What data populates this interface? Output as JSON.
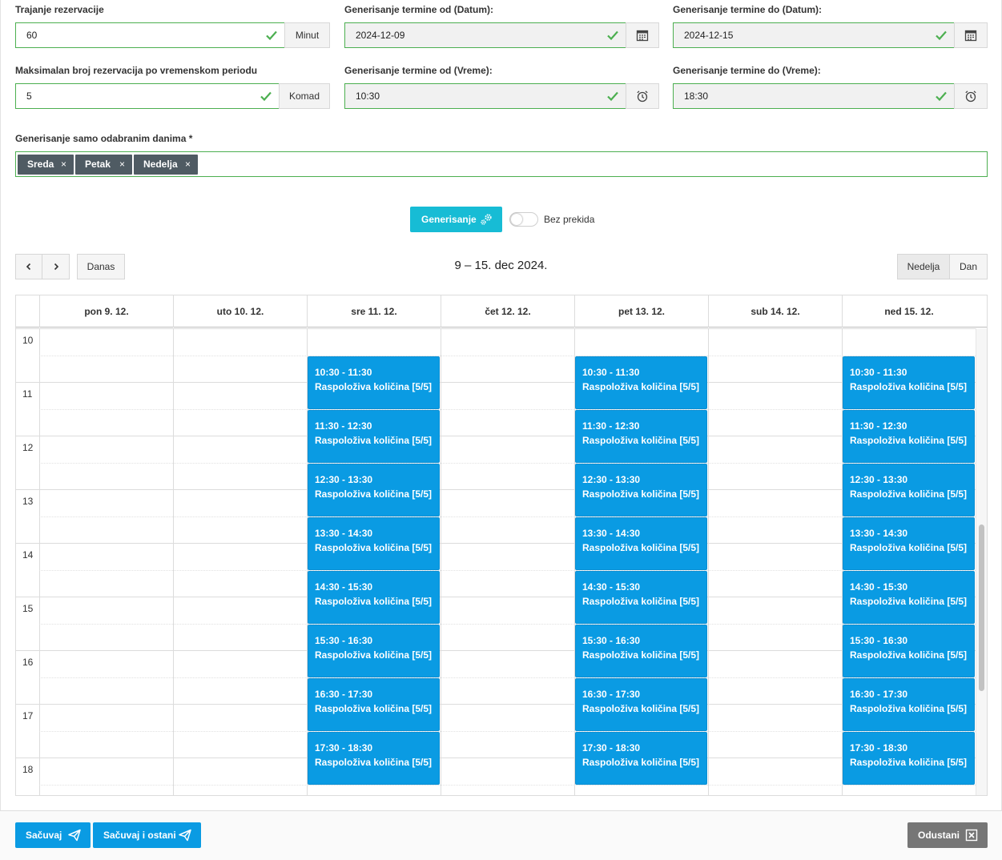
{
  "form": {
    "duration": {
      "label": "Trajanje rezervacije",
      "value": "60",
      "unit": "Minut"
    },
    "date_from": {
      "label": "Generisanje termine od (Datum):",
      "value": "2024-12-09"
    },
    "date_to": {
      "label": "Generisanje termine do (Datum):",
      "value": "2024-12-15"
    },
    "max_reservations": {
      "label": "Maksimalan broj rezervacija po vremenskom periodu",
      "value": "5",
      "unit": "Komad"
    },
    "time_from": {
      "label": "Generisanje termine od (Vreme):",
      "value": "10:30"
    },
    "time_to": {
      "label": "Generisanje termine do (Vreme):",
      "value": "18:30"
    },
    "days": {
      "label": "Generisanje samo odabranim danima *",
      "tags": [
        "Sreda",
        "Petak",
        "Nedelja"
      ],
      "remove_glyph": "×"
    }
  },
  "actions": {
    "generate_label": "Generisanje",
    "toggle_label": "Bez prekida",
    "toggle_on": false
  },
  "calendar": {
    "prev": "‹",
    "next": "›",
    "today": "Danas",
    "title": "9 – 15. dec 2024.",
    "view_week": "Nedelja",
    "view_day": "Dan",
    "days": [
      "pon 9. 12.",
      "uto 10. 12.",
      "sre 11. 12.",
      "čet 12. 12.",
      "pet 13. 12.",
      "sub 14. 12.",
      "ned 15. 12."
    ],
    "hours": [
      "10",
      "11",
      "12",
      "13",
      "14",
      "15",
      "16",
      "17",
      "18"
    ],
    "event_days": [
      2,
      4,
      6
    ],
    "events": [
      {
        "time": "10:30 - 11:30",
        "label": "Raspoloživa količina [5/5]"
      },
      {
        "time": "11:30 - 12:30",
        "label": "Raspoloživa količina [5/5]"
      },
      {
        "time": "12:30 - 13:30",
        "label": "Raspoloživa količina [5/5]"
      },
      {
        "time": "13:30 - 14:30",
        "label": "Raspoloživa količina [5/5]"
      },
      {
        "time": "14:30 - 15:30",
        "label": "Raspoloživa količina [5/5]"
      },
      {
        "time": "15:30 - 16:30",
        "label": "Raspoloživa količina [5/5]"
      },
      {
        "time": "16:30 - 17:30",
        "label": "Raspoloživa količina [5/5]"
      },
      {
        "time": "17:30 - 18:30",
        "label": "Raspoloživa količina [5/5]"
      }
    ],
    "event_color": "#0a9be3"
  },
  "footer": {
    "save": "Sačuvaj",
    "save_stay": "Sačuvaj i ostani",
    "cancel": "Odustani"
  }
}
